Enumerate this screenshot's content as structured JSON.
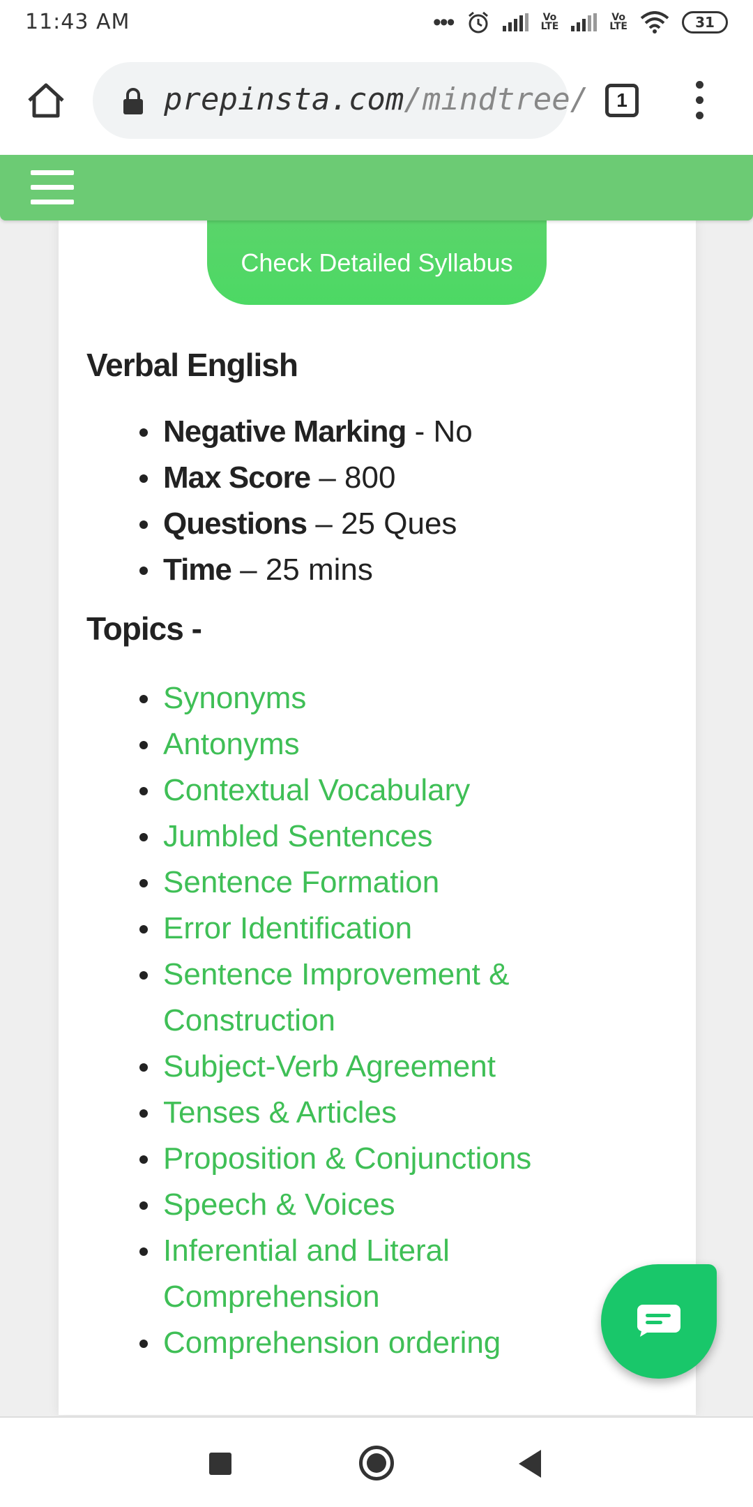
{
  "status_bar": {
    "time": "11:43 AM",
    "network_labels": [
      "Vo LTE",
      "Vo LTE"
    ],
    "battery": "31"
  },
  "browser": {
    "url_domain": "prepinsta.com",
    "url_path": "/mindtree/",
    "tab_count": "1"
  },
  "content": {
    "syllabus_button": "Check Detailed Syllabus",
    "section_title": "Verbal English",
    "details": [
      {
        "key": "Negative Marking",
        "sep": " -  ",
        "value": "No"
      },
      {
        "key": "Max Score",
        "sep": " – ",
        "value": "800"
      },
      {
        "key": "Questions",
        "sep": " – ",
        "value": "25 Ques"
      },
      {
        "key": "Time",
        "sep": " – ",
        "value": "25 mins"
      }
    ],
    "topics_title": "Topics -",
    "topics": [
      "Synonyms",
      "Antonyms",
      "Contextual Vocabulary",
      "Jumbled Sentences",
      "Sentence Formation",
      "Error Identification",
      "Sentence Improvement & Construction",
      "Subject-Verb Agreement",
      "Tenses & Articles",
      "Proposition & Conjunctions",
      "Speech & Voices",
      "Inferential and Literal Comprehension",
      "Comprehension ordering"
    ]
  },
  "colors": {
    "header_green": "#6ccb74",
    "button_green": "#4cd964",
    "link_green": "#3fbf56",
    "fab_green": "#19c76a"
  },
  "icons": [
    "home-icon",
    "lock-icon",
    "tabs-icon",
    "menu-icon",
    "hamburger-icon",
    "chat-icon",
    "alarm-icon",
    "wifi-icon"
  ]
}
